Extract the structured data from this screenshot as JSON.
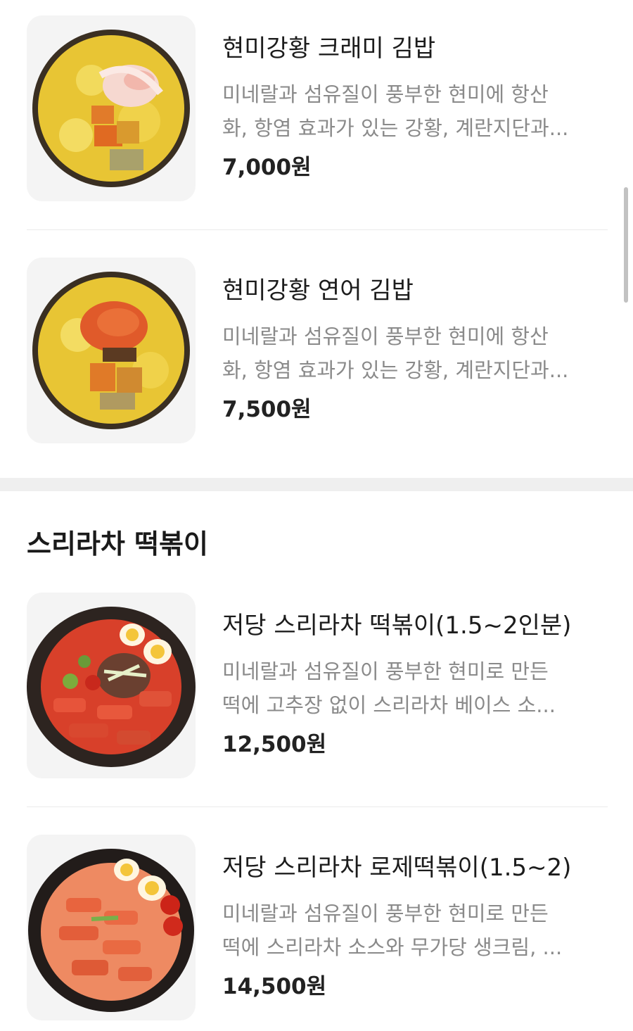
{
  "section1": {
    "items": [
      {
        "name": "현미강황 크래미 김밥",
        "desc_line1": "미네랄과 섬유질이 풍부한 현미에 항산",
        "desc_line2": "화, 항염 효과가 있는 강황, 계란지단과...",
        "price": "7,000원",
        "image_icon": "gimbap-crab-image"
      },
      {
        "name": "현미강황 연어 김밥",
        "desc_line1": "미네랄과 섬유질이 풍부한 현미에 항산",
        "desc_line2": "화, 항염 효과가 있는 강황, 계란지단과...",
        "price": "7,500원",
        "image_icon": "gimbap-salmon-image"
      }
    ]
  },
  "section2": {
    "title": "스리라차 떡볶이",
    "items": [
      {
        "name": "저당 스리라차 떡볶이(1.5~2인분)",
        "desc_line1": "미네랄과 섬유질이 풍부한 현미로 만든",
        "desc_line2": "떡에 고추장 없이 스리라차 베이스 소...",
        "price": "12,500원",
        "image_icon": "tteokbokki-image"
      },
      {
        "name": "저당 스리라차 로제떡볶이(1.5~2)",
        "desc_line1": "미네랄과 섬유질이 풍부한 현미로 만든",
        "desc_line2": "떡에 스리라차 소스와 무가당 생크림, ...",
        "price": "14,500원",
        "image_icon": "rose-tteokbokki-image"
      }
    ]
  },
  "colors": {
    "background": "#ffffff",
    "thumb_bg": "#f4f4f4",
    "text_primary": "#1c1c1c",
    "text_secondary": "#8a8a8a",
    "divider": "#ebebeb",
    "section_gap": "#efefef"
  }
}
